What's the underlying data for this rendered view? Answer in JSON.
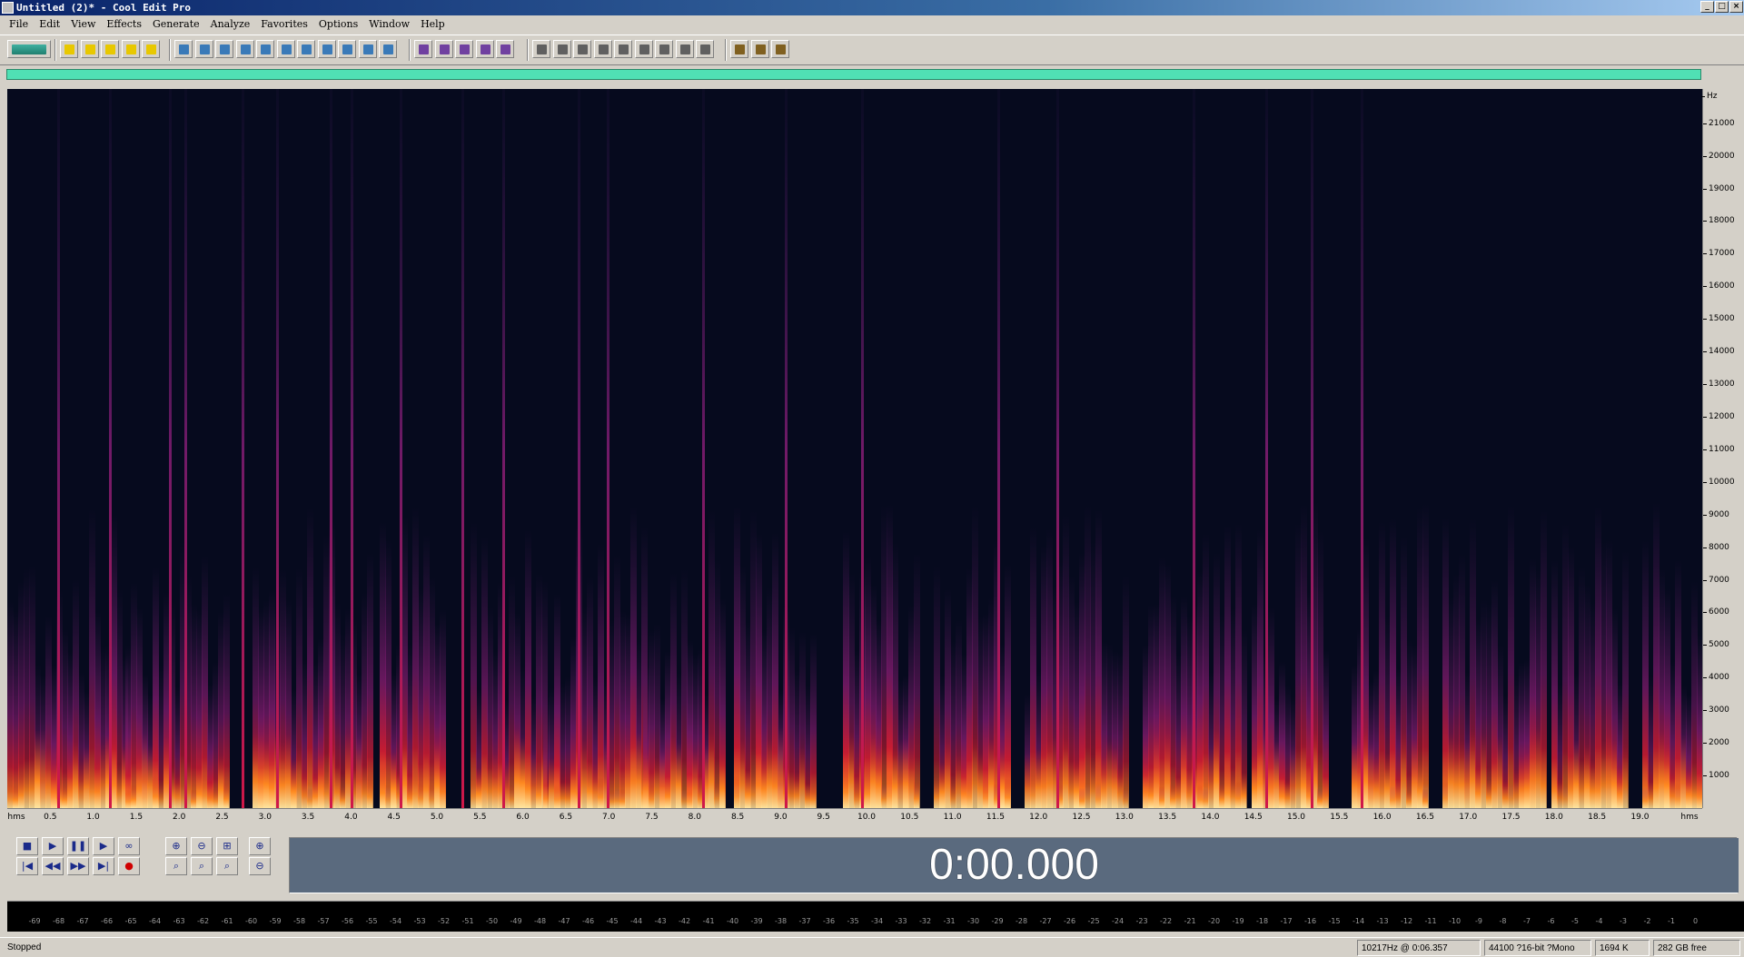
{
  "window": {
    "title": "Untitled (2)* - Cool Edit Pro"
  },
  "menu": [
    "File",
    "Edit",
    "View",
    "Effects",
    "Generate",
    "Analyze",
    "Favorites",
    "Options",
    "Window",
    "Help"
  ],
  "colors": {
    "background": "#060a1e",
    "hot": "#ffd080",
    "mid": "#c81c32",
    "low": "#4a1a5a"
  },
  "freq_axis": {
    "unit": "Hz",
    "ticks": [
      "21000",
      "20000",
      "19000",
      "18000",
      "17000",
      "16000",
      "15000",
      "14000",
      "13000",
      "12000",
      "11000",
      "10000",
      "9000",
      "8000",
      "7000",
      "6000",
      "5000",
      "4000",
      "3000",
      "2000",
      "1000"
    ]
  },
  "time_axis": {
    "unit": "hms",
    "ticks": [
      "0.5",
      "1.0",
      "1.5",
      "2.0",
      "2.5",
      "3.0",
      "3.5",
      "4.0",
      "4.5",
      "5.0",
      "5.5",
      "6.0",
      "6.5",
      "7.0",
      "7.5",
      "8.0",
      "8.5",
      "9.0",
      "9.5",
      "10.0",
      "10.5",
      "11.0",
      "11.5",
      "12.0",
      "12.5",
      "13.0",
      "13.5",
      "14.0",
      "14.5",
      "15.0",
      "15.5",
      "16.0",
      "16.5",
      "17.0",
      "17.5",
      "18.0",
      "18.5",
      "19.0"
    ]
  },
  "transport": {
    "time": "0:00.000"
  },
  "meter": {
    "scale": [
      "-69",
      "-68",
      "-67",
      "-66",
      "-65",
      "-64",
      "-63",
      "-62",
      "-61",
      "-60",
      "-59",
      "-58",
      "-57",
      "-56",
      "-55",
      "-54",
      "-53",
      "-52",
      "-51",
      "-50",
      "-49",
      "-48",
      "-47",
      "-46",
      "-45",
      "-44",
      "-43",
      "-42",
      "-41",
      "-40",
      "-39",
      "-38",
      "-37",
      "-36",
      "-35",
      "-34",
      "-33",
      "-32",
      "-31",
      "-30",
      "-29",
      "-28",
      "-27",
      "-26",
      "-25",
      "-24",
      "-23",
      "-22",
      "-21",
      "-20",
      "-19",
      "-18",
      "-17",
      "-16",
      "-15",
      "-14",
      "-13",
      "-12",
      "-11",
      "-10",
      "-9",
      "-8",
      "-7",
      "-6",
      "-5",
      "-4",
      "-3",
      "-2",
      "-1",
      "0"
    ]
  },
  "status": {
    "state": "Stopped",
    "cursor": "10217Hz @  0:06.357",
    "format": "44100 ?16-bit ?Mono",
    "size": "1694 K",
    "free": "282 GB free"
  }
}
